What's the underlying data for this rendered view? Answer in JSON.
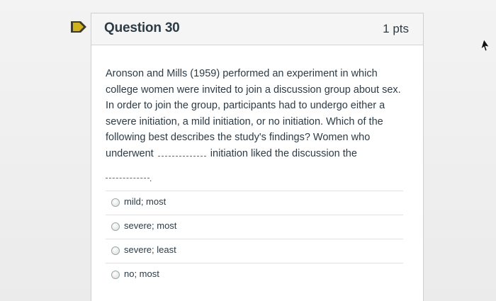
{
  "question": {
    "title": "Question 30",
    "points": "1 pts",
    "text_line1": "Aronson and Mills (1959) performed an experiment in which",
    "text_line2": "college women were invited to join a discussion group about sex.",
    "text_line3": "In order to join the group, participants had to undergo either a",
    "text_line4": "severe initiation, a mild initiation, or no initiation. Which of the",
    "text_line5": "following best describes the study's findings? Women who",
    "text_line6a": "underwent",
    "text_line6b": "initiation liked the discussion the",
    "trailing_punct": "."
  },
  "answers": [
    {
      "label": "mild; most"
    },
    {
      "label": "severe; most"
    },
    {
      "label": "severe; least"
    },
    {
      "label": "no; most"
    }
  ],
  "colors": {
    "flag": "#3d3b2a",
    "text": "#2d3b45"
  }
}
